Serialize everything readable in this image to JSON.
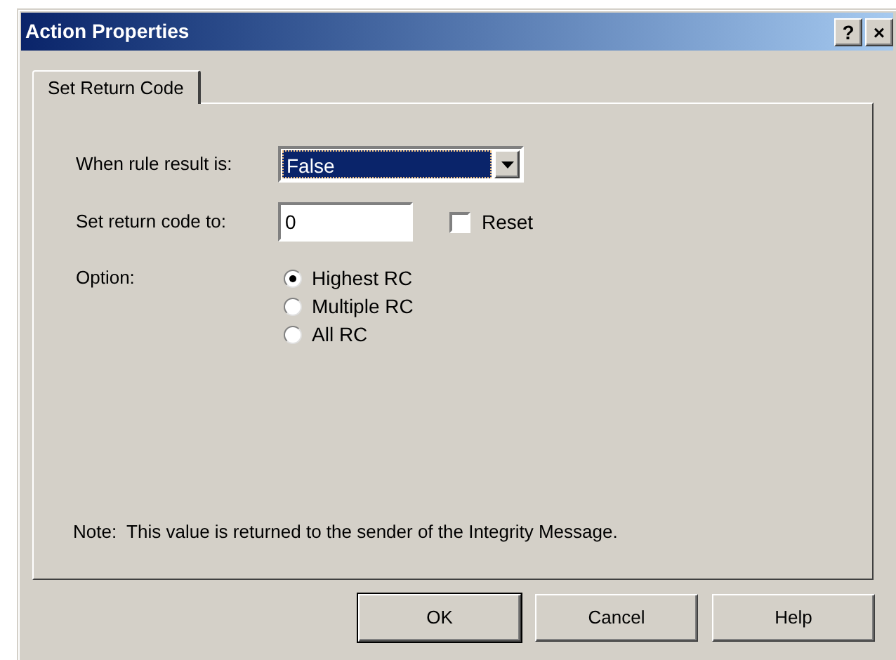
{
  "window": {
    "title": "Action Properties",
    "title_buttons": [
      "?",
      "×"
    ]
  },
  "tabs": [
    {
      "label": "Set Return Code",
      "selected": true
    }
  ],
  "rule_result": {
    "label": "When rule result is:",
    "value": "False",
    "focused": true
  },
  "return_code": {
    "label": "Set return code to:",
    "value": "0"
  },
  "reset": {
    "label": "Reset",
    "checked": false
  },
  "option": {
    "label": "Option:",
    "choices": [
      {
        "label": "Highest RC",
        "selected": true
      },
      {
        "label": "Multiple RC",
        "selected": false
      },
      {
        "label": "All RC",
        "selected": false
      }
    ]
  },
  "note": "Note:  This value is returned to the sender of the Integrity Message.",
  "buttons": [
    {
      "label": "OK",
      "default": true
    },
    {
      "label": "Cancel",
      "default": false
    },
    {
      "label": "Help",
      "default": false
    }
  ]
}
